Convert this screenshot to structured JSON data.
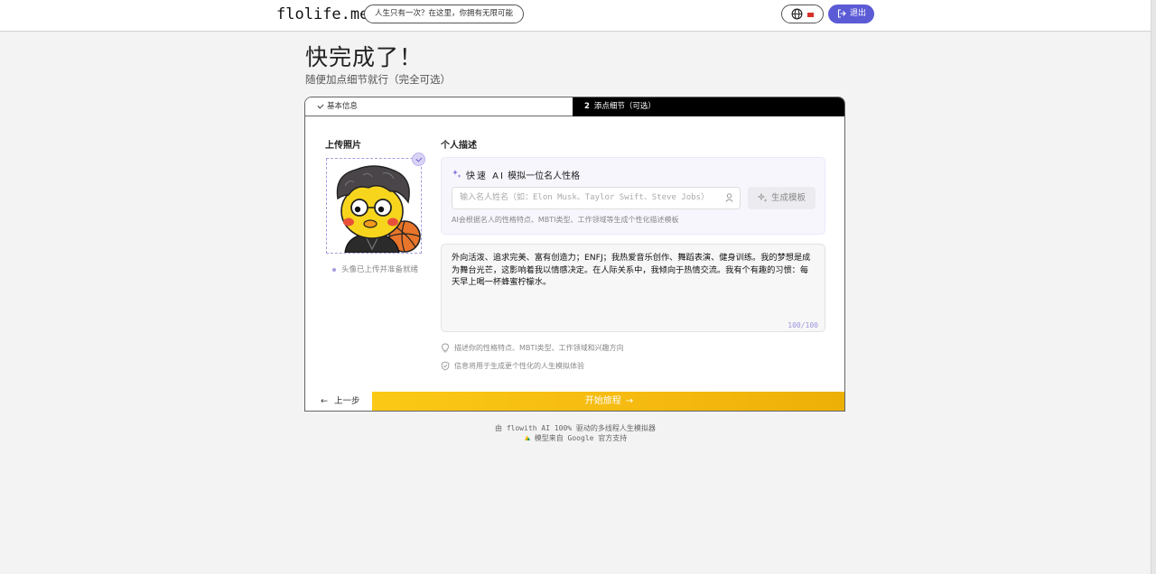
{
  "header": {
    "logo": "flolife.me",
    "slogan": "人生只有一次？在这里，你拥有无限可能",
    "logout_label": "退出"
  },
  "page": {
    "title": "快完成了！",
    "subtitle": "随便加点细节就行（完全可选）"
  },
  "steps": {
    "step1_label": "基本信息",
    "step2_num": "2",
    "step2_label": "添点细节（可选）"
  },
  "photo": {
    "label": "上传照片",
    "status": "头像已上传并准备就绪"
  },
  "description": {
    "label": "个人描述",
    "ai_title_prefix": "快速 AI",
    "ai_title_rest": " 模拟一位名人性格",
    "ai_placeholder": "输入名人姓名（如：Elon Musk、Taylor Swift、Steve Jobs）",
    "generate_label": "生成模板",
    "ai_hint": "AI会根据名人的性格特点、MBTI类型、工作领域等生成个性化描述模板",
    "text": "外向活泼、追求完美、富有创造力；ENFJ；我热爱音乐创作、舞蹈表演、健身训练。我的梦想是成为舞台光芒，这影响着我以情感决定。在人际关系中，我倾向于热情交流。我有个有趣的习惯：每天早上喝一杯蜂蜜柠檬水。",
    "char_count": "100/100",
    "tip1": "描述你的性格特点、MBTI类型、工作领域和兴趣方向",
    "tip2": "信息将用于生成更个性化的人生模拟体验"
  },
  "actions": {
    "back_label": "上一步",
    "start_label": "开始旅程"
  },
  "footer": {
    "line1": "由 flowith AI 100% 驱动的多线程人生模拟器",
    "line2": "模型来自 Google 官方支持"
  },
  "colors": {
    "accent": "#5b5bd6",
    "start_button": "#f5b90f",
    "active_tab": "#000000"
  }
}
